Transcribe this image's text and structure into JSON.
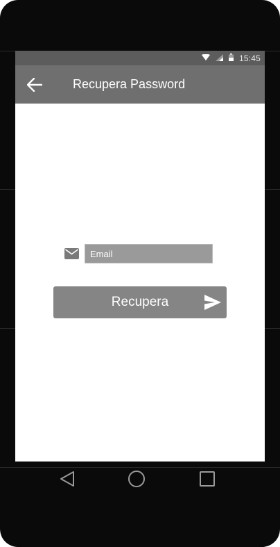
{
  "statusbar": {
    "time": "15:45",
    "icons": [
      "wifi-icon",
      "signal-icon",
      "battery-icon"
    ]
  },
  "appbar": {
    "title": "Recupera Password",
    "back_icon": "arrow-back-icon"
  },
  "form": {
    "email_placeholder": "Email",
    "email_value": "",
    "email_icon": "mail-icon",
    "submit_label": "Recupera",
    "submit_icon": "send-icon"
  },
  "navbar": {
    "icons": [
      "nav-back-icon",
      "nav-home-icon",
      "nav-recents-icon"
    ]
  },
  "colors": {
    "appbar": "#6f6f6f",
    "statusbar": "#5c5c5c",
    "button": "#858585",
    "input": "#9a9a9a",
    "device": "#0a0a0a"
  }
}
